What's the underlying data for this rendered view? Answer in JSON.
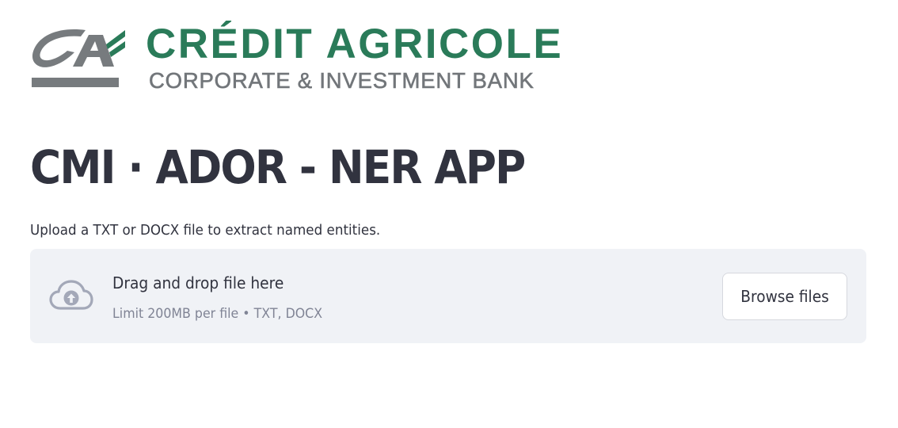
{
  "logo": {
    "name": "CRÉDIT AGRICOLE",
    "subtitle": "CORPORATE & INVESTMENT BANK",
    "brand_green": "#2a7b59",
    "brand_gray": "#72767a"
  },
  "page": {
    "title": "CMI · ADOR - NER APP",
    "subtitle": "Upload a TXT or DOCX file to extract named entities."
  },
  "uploader": {
    "icon": "cloud-upload-icon",
    "drop_text": "Drag and drop file here",
    "limit_text": "Limit 200MB per file • TXT, DOCX",
    "browse_label": "Browse files"
  },
  "colors": {
    "text": "#31333f",
    "muted": "#808495",
    "dropzone_bg": "#f0f2f6",
    "icon": "#a3a8b8"
  }
}
